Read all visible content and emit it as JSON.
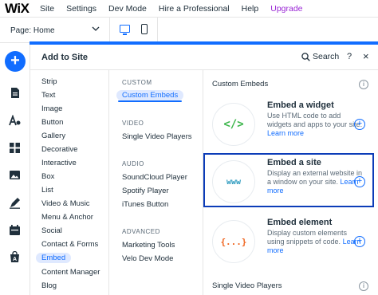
{
  "topbar": {
    "logo": "WiX",
    "menu": [
      "Site",
      "Settings",
      "Dev Mode",
      "Hire a Professional",
      "Help",
      "Upgrade"
    ]
  },
  "pagebar": {
    "page_label": "Page: Home",
    "active_device": "desktop"
  },
  "rail": {
    "add_label": "+",
    "icons": [
      "pages-icon",
      "theme-icon",
      "apps-icon",
      "media-icon",
      "blog-icon",
      "bookings-icon",
      "store-icon"
    ]
  },
  "panel": {
    "title": "Add to Site",
    "search_label": "Search",
    "help_label": "?",
    "close_label": "×"
  },
  "categories": [
    "Strip",
    "Text",
    "Image",
    "Button",
    "Gallery",
    "Decorative",
    "Interactive",
    "Box",
    "List",
    "Video & Music",
    "Menu & Anchor",
    "Social",
    "Contact & Forms",
    "Embed",
    "Content Manager",
    "Blog"
  ],
  "subcategories": {
    "custom_head": "CUSTOM",
    "custom": [
      "Custom Embeds"
    ],
    "video_head": "VIDEO",
    "video": [
      "Single Video Players"
    ],
    "audio_head": "AUDIO",
    "audio": [
      "SoundCloud Player",
      "Spotify Player",
      "iTunes Button"
    ],
    "advanced_head": "ADVANCED",
    "advanced": [
      "Marketing Tools",
      "Velo Dev Mode"
    ]
  },
  "main": {
    "section_title": "Custom Embeds",
    "section2_title": "Single Video Players",
    "info_label": "i",
    "cards": [
      {
        "title": "Embed a widget",
        "desc": "Use HTML code to add widgets and apps to your site.",
        "link": "Learn more",
        "glyph": "</>",
        "color": "#3bb54a"
      },
      {
        "title": "Embed a site",
        "desc": "Display an external website in a window on your site.",
        "link": "Learn more",
        "glyph": "www",
        "color": "#2f9bbf"
      },
      {
        "title": "Embed element",
        "desc": "Display custom elements using snippets of code.",
        "link": "Learn more",
        "glyph": "{...}",
        "color": "#f0641e"
      }
    ]
  }
}
